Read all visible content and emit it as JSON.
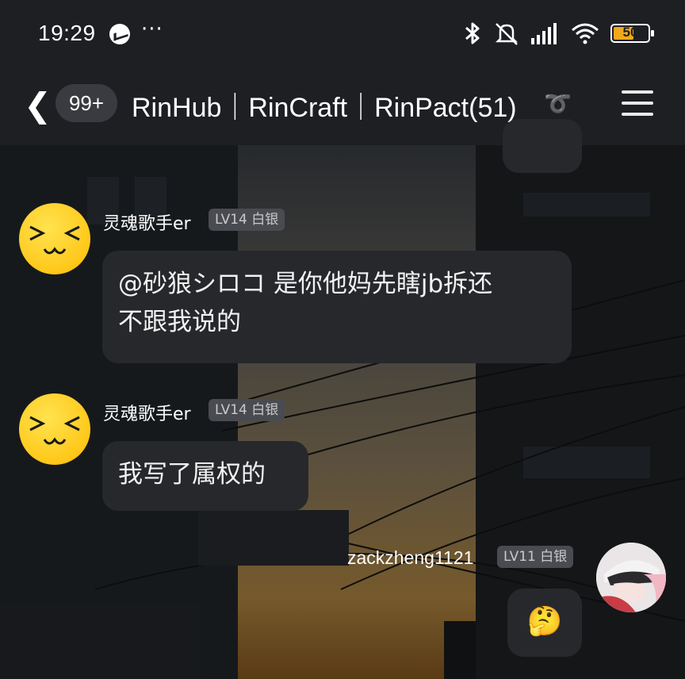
{
  "status_bar": {
    "time": "19:29",
    "more": "···",
    "battery": "50"
  },
  "header": {
    "unread_count": "99+",
    "title": "RinHub｜RinCraft｜RinPact(51)"
  },
  "messages": [
    {
      "sender": "灵魂歌手er",
      "badge": "LV14 白银",
      "text_line1": "@砂狼シロコ 是你他妈先瞎jb拆还",
      "text_line2": "不跟我说的"
    },
    {
      "sender": "灵魂歌手er",
      "badge": "LV14 白银",
      "text": "我写了属权的"
    },
    {
      "sender": "zackzheng1121",
      "badge": "LV11 白银",
      "text": "🤔"
    }
  ],
  "colors": {
    "bar_bg": "#1e1f23",
    "bubble_bg": "#27282c",
    "badge_bg": "#494b50",
    "battery_fill": "#f0a91c",
    "avatar_yellow": "#ffc81a"
  },
  "icons": [
    "messenger-icon",
    "bluetooth-icon",
    "mute-icon",
    "signal-icon",
    "wifi-icon",
    "battery-icon",
    "back-icon",
    "ear-icon",
    "menu-icon"
  ]
}
